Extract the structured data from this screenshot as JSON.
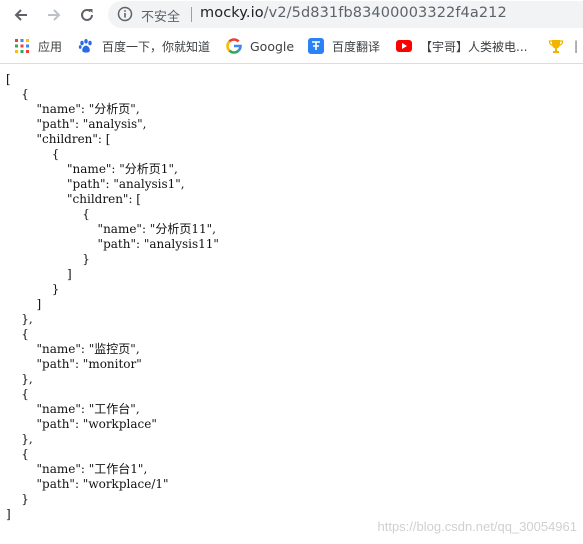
{
  "browser": {
    "security_label": "不安全",
    "url_host": "mocky.io",
    "url_path": "/v2/5d831fb83400003322f4a212"
  },
  "bookmarks": [
    {
      "label": "应用",
      "icon": "apps-grid-icon"
    },
    {
      "label": "百度一下，你就知道",
      "icon": "baidu-paw-icon"
    },
    {
      "label": "Google",
      "icon": "google-g-icon"
    },
    {
      "label": "百度翻译",
      "icon": "translate-icon"
    },
    {
      "label": "【宇哥】人类被电...",
      "icon": "youtube-icon"
    }
  ],
  "response": {
    "json_text": "[\n    {\n        \"name\": \"分析页\",\n        \"path\": \"analysis\",\n        \"children\": [\n            {\n                \"name\": \"分析页1\",\n                \"path\": \"analysis1\",\n                \"children\": [\n                    {\n                        \"name\": \"分析页11\",\n                        \"path\": \"analysis11\"\n                    }\n                ]\n            }\n        ]\n    },\n    {\n        \"name\": \"监控页\",\n        \"path\": \"monitor\"\n    },\n    {\n        \"name\": \"工作台\",\n        \"path\": \"workplace\"\n    },\n    {\n        \"name\": \"工作台1\",\n        \"path\": \"workplace/1\"\n    }\n]"
  },
  "watermark": "https://blog.csdn.net/qq_30054961",
  "colors": {
    "google_blue": "#4285f4",
    "google_red": "#ea4335",
    "google_yellow": "#fbbc05",
    "google_green": "#34a853",
    "youtube_red": "#ff0000",
    "translate_blue": "#2b82f6"
  }
}
